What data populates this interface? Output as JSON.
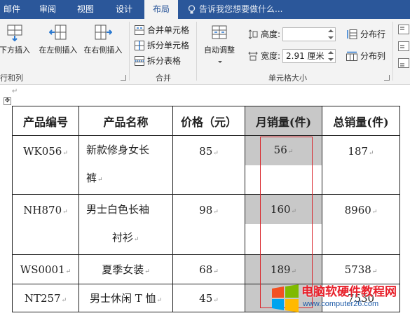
{
  "tabs": [
    {
      "label": "邮件",
      "active": false
    },
    {
      "label": "审阅",
      "active": false
    },
    {
      "label": "视图",
      "active": false
    },
    {
      "label": "设计",
      "active": false
    },
    {
      "label": "布局",
      "active": true
    }
  ],
  "tell_me": {
    "placeholder": "告诉我您想要做什么..."
  },
  "ribbon": {
    "rows_cols": {
      "insert_below": "下方插入",
      "insert_left": "在左侧插入",
      "insert_right": "在右侧插入",
      "group_label": "行和列"
    },
    "merge": {
      "merge_cells": "合并单元格",
      "split_cells": "拆分单元格",
      "split_table": "拆分表格",
      "group_label": "合并"
    },
    "cell_size": {
      "autofit": "自动调整",
      "height_label": "高度:",
      "height_value": "",
      "width_label": "宽度:",
      "width_value": "2.91 厘米",
      "distribute_rows": "分布行",
      "distribute_cols": "分布列",
      "group_label": "单元格大小"
    }
  },
  "table": {
    "headers": [
      "产品编号",
      "产品名称",
      "价格（元）",
      "月销量(件)",
      "总销量(件)"
    ],
    "rows": [
      {
        "code": "WK056",
        "name_l1": "新款修身女长",
        "name_l2": "裤",
        "price": "85",
        "monthly": "56",
        "total": "187"
      },
      {
        "code": "NH870",
        "name_l1": "男士白色长袖",
        "name_l2": "衬衫",
        "price": "98",
        "monthly": "160",
        "total": "8960"
      },
      {
        "code": "WS0001",
        "name_l1": "夏季女装",
        "name_l2": "",
        "price": "68",
        "monthly": "189",
        "total": "5738"
      },
      {
        "code": "NT257",
        "name_l1": "男士休闲 T 恤",
        "name_l2": "",
        "price": "45",
        "monthly": "",
        "total": "7530"
      }
    ]
  },
  "watermark": {
    "title": "电脑软硬件教程网",
    "url": "www.computer26.com"
  },
  "colors": {
    "accent": "#2b579a",
    "selection": "#c8c8c8",
    "highlight_box": "#d9262c"
  }
}
